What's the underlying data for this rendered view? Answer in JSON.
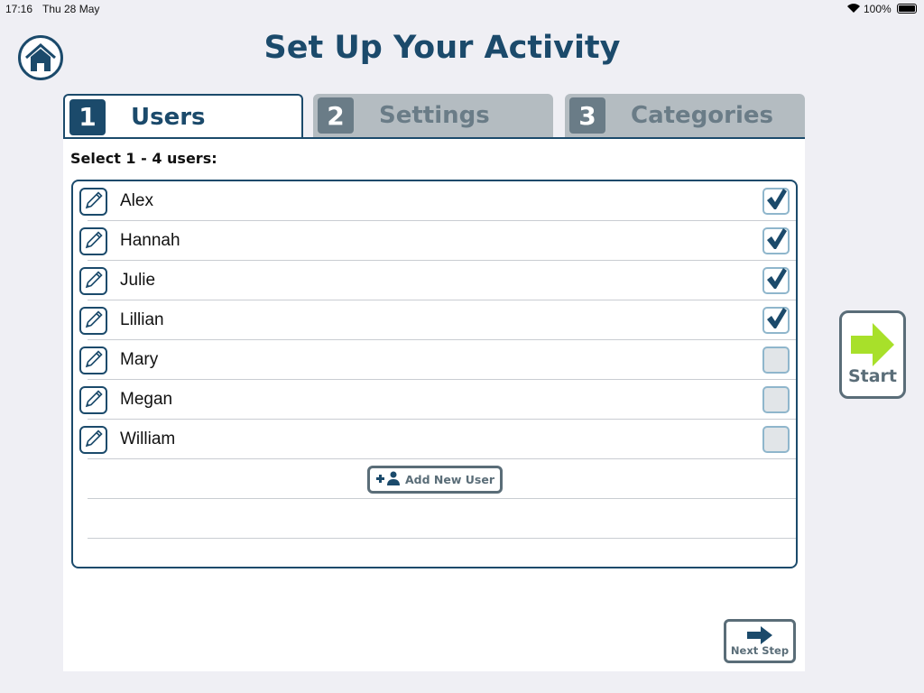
{
  "status": {
    "time": "17:16",
    "date": "Thu 28 May",
    "battery": "100%"
  },
  "header": {
    "title": "Set Up Your Activity"
  },
  "tabs": [
    {
      "num": "1",
      "label": "Users",
      "active": true
    },
    {
      "num": "2",
      "label": "Settings",
      "active": false
    },
    {
      "num": "3",
      "label": "Categories",
      "active": false
    }
  ],
  "main": {
    "prompt": "Select 1 - 4 users:",
    "users": [
      {
        "name": "Alex",
        "checked": true
      },
      {
        "name": "Hannah",
        "checked": true
      },
      {
        "name": "Julie",
        "checked": true
      },
      {
        "name": "Lillian",
        "checked": true
      },
      {
        "name": "Mary",
        "checked": false
      },
      {
        "name": "Megan",
        "checked": false
      },
      {
        "name": "William",
        "checked": false
      }
    ],
    "add_user_label": "Add New User",
    "next_label": "Next Step"
  },
  "start_label": "Start",
  "colors": {
    "primary": "#1b4a6b",
    "accent": "#a8e02a",
    "gray": "#5a6d78"
  }
}
